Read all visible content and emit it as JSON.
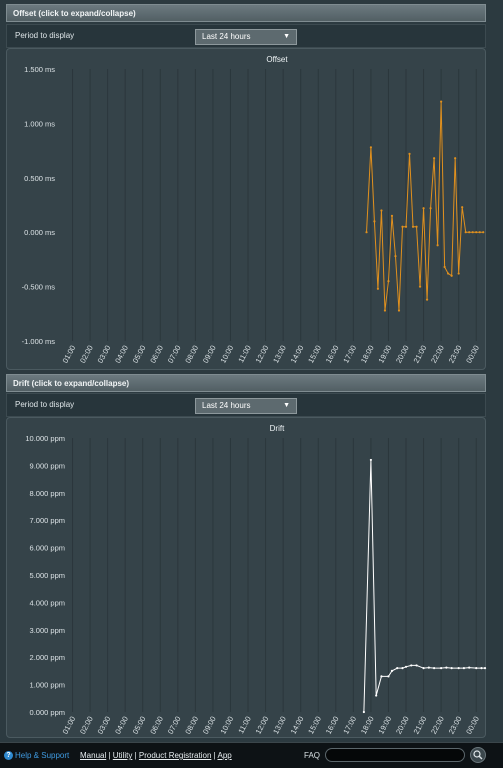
{
  "offset": {
    "header": "Offset (click to expand/collapse)",
    "period_label": "Period to display",
    "period_value": "Last 24 hours"
  },
  "drift": {
    "header": "Drift (click to expand/collapse)",
    "period_label": "Period to display",
    "period_value": "Last 24 hours"
  },
  "footer": {
    "help": "Help & Support",
    "manual": "Manual",
    "utility": "Utility",
    "registration": "Product Registration",
    "app": "App",
    "faq": "FAQ",
    "sep": "|"
  },
  "colors": {
    "offset_line": "#e0901e",
    "drift_line": "#ffffff",
    "grid": "#2b373c",
    "axis_text": "#dce3e6"
  },
  "chart_data": [
    {
      "type": "line",
      "title": "Offset",
      "unit": "ms",
      "ylim": [
        -1.0,
        1.5
      ],
      "yticks": [
        "1.500 ms",
        "1.000 ms",
        "0.500 ms",
        "0.000 ms",
        "-0.500 ms",
        "-1.000 ms"
      ],
      "ytick_values": [
        1.5,
        1.0,
        0.5,
        0.0,
        -0.5,
        -1.0
      ],
      "categories": [
        "01:00",
        "02:00",
        "03:00",
        "04:00",
        "05:00",
        "06:00",
        "07:00",
        "08:00",
        "09:00",
        "10:00",
        "11:00",
        "12:00",
        "13:00",
        "14:00",
        "15:00",
        "16:00",
        "17:00",
        "18:00",
        "19:00",
        "20:00",
        "21:00",
        "22:00",
        "23:00",
        "00:00"
      ],
      "grid": true,
      "series": [
        {
          "x": [
            17.75,
            18.0,
            18.2,
            18.4,
            18.6,
            18.8,
            19.0,
            19.2,
            19.4,
            19.6,
            19.8,
            20.0,
            20.2,
            20.4,
            20.6,
            20.8,
            21.0,
            21.2,
            21.4,
            21.6,
            21.8,
            22.0,
            22.2,
            22.4,
            22.6,
            22.8,
            23.0,
            23.2,
            23.4,
            23.6,
            23.8,
            24.0,
            24.2,
            24.4
          ],
          "y": [
            0.0,
            0.78,
            0.1,
            -0.52,
            0.2,
            -0.72,
            -0.45,
            0.15,
            -0.22,
            -0.72,
            0.05,
            0.05,
            0.72,
            0.05,
            0.05,
            -0.5,
            0.22,
            -0.62,
            0.22,
            0.68,
            -0.12,
            1.2,
            -0.32,
            -0.38,
            -0.4,
            0.68,
            -0.38,
            0.23,
            0.0,
            0.0,
            0.0,
            0.0,
            0.0,
            0.0
          ]
        }
      ]
    },
    {
      "type": "line",
      "title": "Drift",
      "unit": "ppm",
      "ylim": [
        0,
        10
      ],
      "yticks": [
        "10.000 ppm",
        "9.000 ppm",
        "8.000 ppm",
        "7.000 ppm",
        "6.000 ppm",
        "5.000 ppm",
        "4.000 ppm",
        "3.000 ppm",
        "2.000 ppm",
        "1.000 ppm",
        "0.000 ppm"
      ],
      "ytick_values": [
        10,
        9,
        8,
        7,
        6,
        5,
        4,
        3,
        2,
        1,
        0
      ],
      "categories": [
        "01:00",
        "02:00",
        "03:00",
        "04:00",
        "05:00",
        "06:00",
        "07:00",
        "08:00",
        "09:00",
        "10:00",
        "11:00",
        "12:00",
        "13:00",
        "14:00",
        "15:00",
        "16:00",
        "17:00",
        "18:00",
        "19:00",
        "20:00",
        "21:00",
        "22:00",
        "23:00",
        "00:00"
      ],
      "grid": true,
      "series": [
        {
          "x": [
            17.6,
            18.0,
            18.3,
            18.6,
            19.0,
            19.2,
            19.5,
            19.8,
            20.0,
            20.3,
            20.6,
            21.0,
            21.3,
            21.6,
            22.0,
            22.3,
            22.6,
            23.0,
            23.3,
            23.6,
            24.0,
            24.3,
            24.5
          ],
          "y": [
            0.0,
            9.2,
            0.6,
            1.3,
            1.3,
            1.5,
            1.6,
            1.6,
            1.65,
            1.7,
            1.7,
            1.6,
            1.62,
            1.6,
            1.6,
            1.62,
            1.6,
            1.6,
            1.6,
            1.62,
            1.6,
            1.6,
            1.6
          ]
        }
      ]
    }
  ]
}
